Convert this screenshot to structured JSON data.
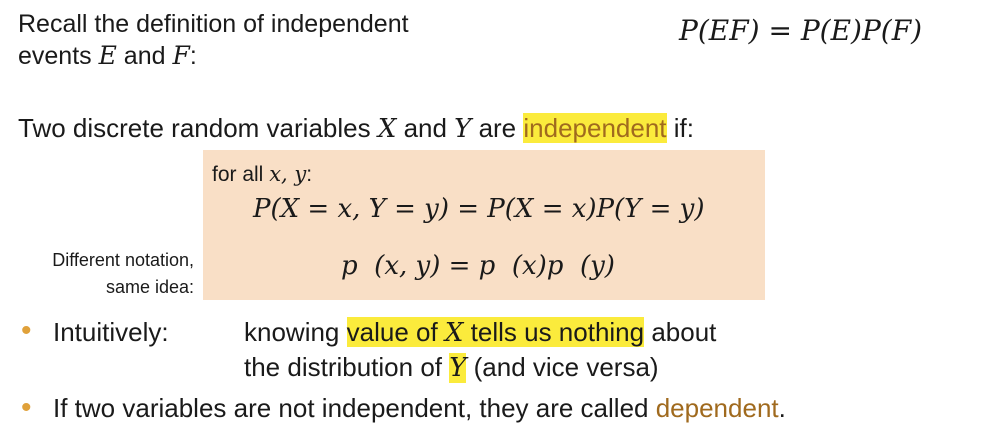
{
  "recall": {
    "line1": "Recall the definition of independent",
    "line2_prefix": "events ",
    "var_e": "E",
    "and": " and ",
    "var_f": "F",
    "colon": ":"
  },
  "formula_events": "P(EF) = P(E)P(F)",
  "definition": {
    "prefix": "Two discrete random variables ",
    "var_x": "X",
    "and": " and ",
    "var_y": "Y",
    "are": " are ",
    "term": "independent",
    "suffix": " if:"
  },
  "box": {
    "for_all": "for all ",
    "for_all_vars": "x, y",
    "for_all_colon": ":",
    "formula1": "P(X = x, Y = y) = P(X = x)P(Y = y)",
    "formula2": "p  (x, y) = p  (x)p  (y)"
  },
  "side_note": {
    "line1": "Different notation,",
    "line2": "same idea:"
  },
  "bullets": [
    {
      "label": "Intuitively:",
      "text_a": "knowing ",
      "highlight_a": "value of ",
      "highlight_var": "X",
      "highlight_b": " tells us nothing",
      "text_b": " about",
      "line2_prefix": "the distribution of ",
      "line2_var": "Y",
      "line2_suffix": " (and vice versa)"
    },
    {
      "text": "If two variables are not independent, they are called ",
      "term": "dependent",
      "end": "."
    }
  ],
  "colors": {
    "highlight": "#fbeb3c",
    "box_fill": "#f9dfc6",
    "term_brown": "#a06a1e",
    "bullet": "#e0a13a"
  }
}
